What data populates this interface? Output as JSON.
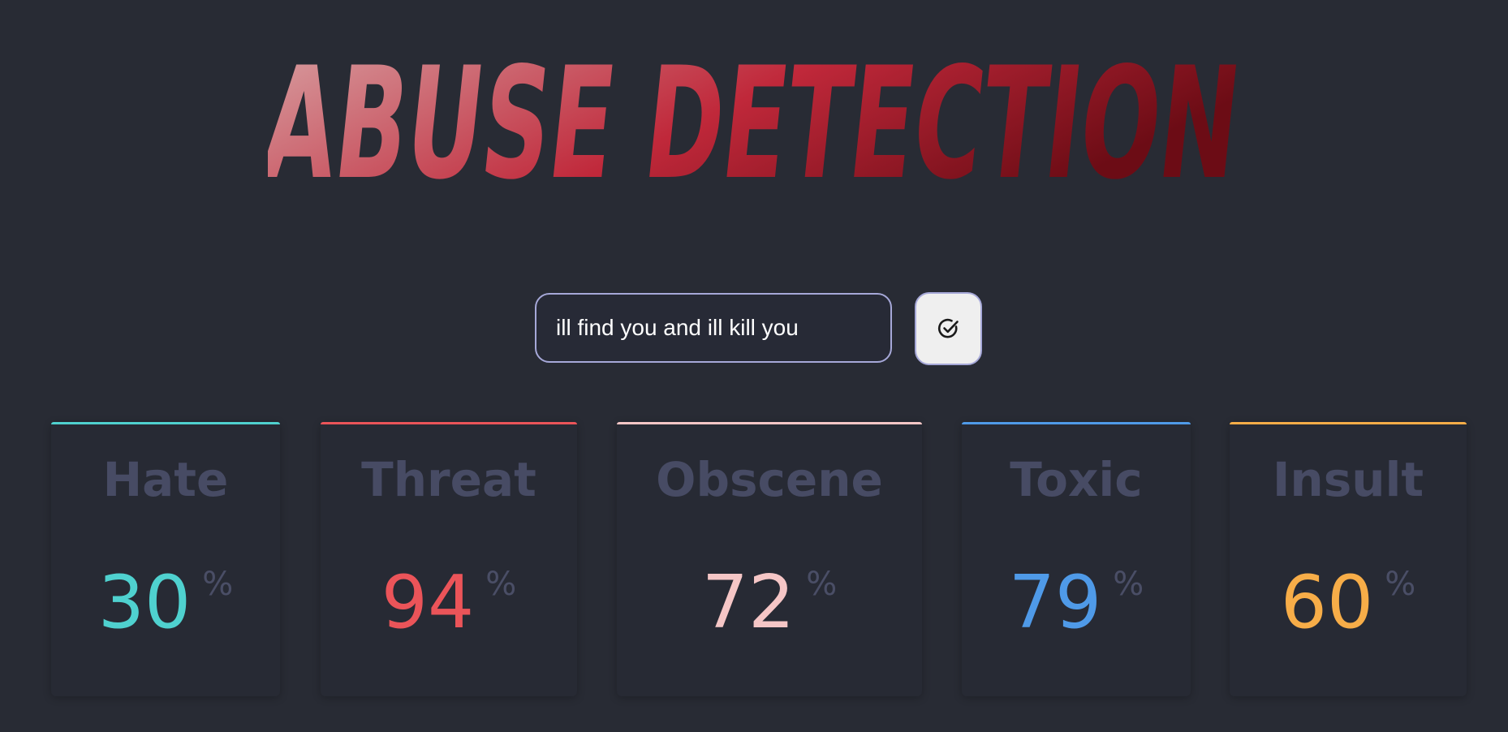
{
  "header": {
    "title": "ABUSE DETECTION"
  },
  "search": {
    "value": "ill find you and ill kill you",
    "submit_icon": "check-circle-icon"
  },
  "colors": {
    "background": "#282b34",
    "label": "#474b64",
    "title_gradient_start": "#d49a9c",
    "title_gradient_mid": "#c22a3c",
    "title_gradient_end": "#6e0d16"
  },
  "cards": [
    {
      "label": "Hate",
      "value": "30",
      "unit": "%",
      "color": "#4fd1cf"
    },
    {
      "label": "Threat",
      "value": "94",
      "unit": "%",
      "color": "#eb5459"
    },
    {
      "label": "Obscene",
      "value": "72",
      "unit": "%",
      "color": "#f5c6c6"
    },
    {
      "label": "Toxic",
      "value": "79",
      "unit": "%",
      "color": "#4f9ae8"
    },
    {
      "label": "Insult",
      "value": "60",
      "unit": "%",
      "color": "#f7ad48"
    }
  ]
}
